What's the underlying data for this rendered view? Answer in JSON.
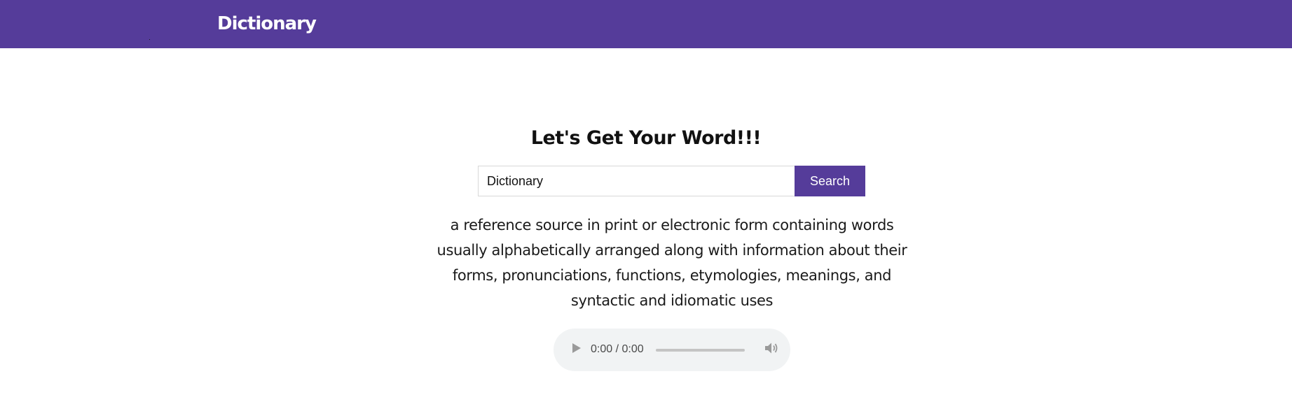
{
  "header": {
    "brand": "Dictionary"
  },
  "main": {
    "heading": "Let's Get Your Word!!!",
    "search": {
      "value": "Dictionary",
      "placeholder": "",
      "button_label": "Search"
    },
    "definition": "a reference source in print or electronic form containing words usually alphabetically arranged along with information about their forms, pronunciations, functions, etymologies, meanings, and syntactic and idiomatic uses",
    "audio": {
      "time": "0:00 / 0:00",
      "progress": 0,
      "play_icon": "play-icon",
      "volume_icon": "volume-icon"
    }
  },
  "colors": {
    "brand": "#553c9a",
    "page_background": "#ffffff",
    "player_background": "#f1f3f4"
  }
}
